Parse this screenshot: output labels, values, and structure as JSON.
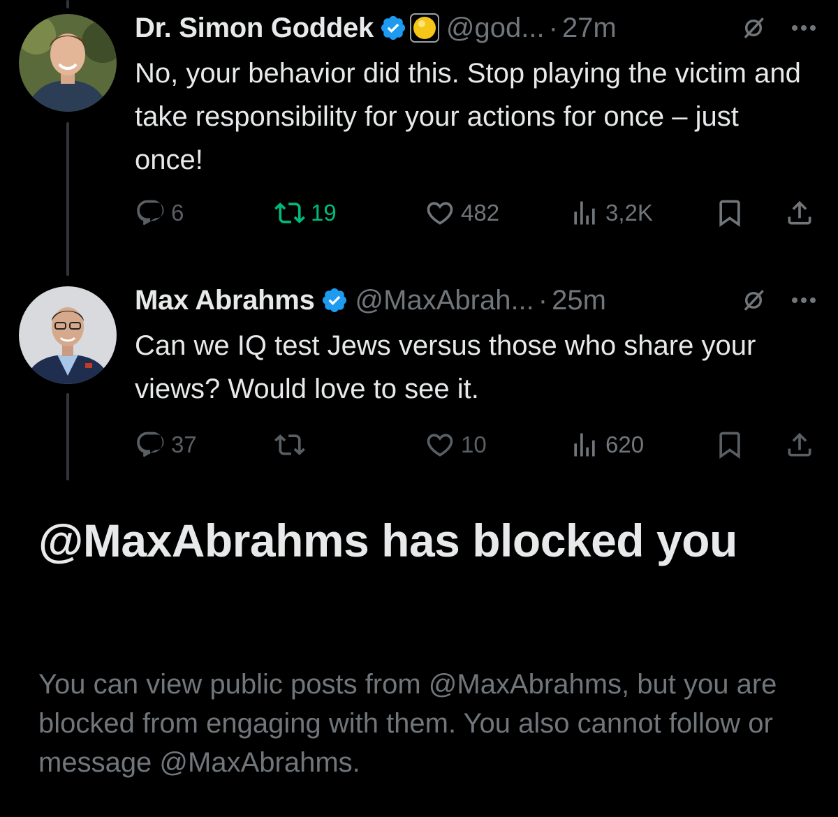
{
  "colors": {
    "background": "#000000",
    "primary_text": "#e7e9ea",
    "secondary_text": "#71767b",
    "verified_blue": "#1d9bf0",
    "retweet_green": "#00ba7c",
    "thread_line": "#333639"
  },
  "posts": [
    {
      "author_name": "Dr. Simon Goddek",
      "handle": "@god...",
      "separator": "·",
      "time": "27m",
      "verified": true,
      "badge_icon": "yellow-circle-emoji-icon",
      "text": "No, your behavior did this. Stop playing the victim and take responsibility for your actions for once – just once!",
      "stats": {
        "replies": "6",
        "reposts": "19",
        "likes": "482",
        "views": "3,2K"
      },
      "reposted": true
    },
    {
      "author_name": "Max Abrahms",
      "handle": "@MaxAbrah...",
      "separator": "·",
      "time": "25m",
      "verified": true,
      "text": "Can we IQ test Jews versus those who share your views? Would love to see it.",
      "stats": {
        "replies": "37",
        "reposts": "",
        "likes": "10",
        "views": "620"
      },
      "reposted": false
    }
  ],
  "block_notice": {
    "title": "@MaxAbrahms has blocked you",
    "body": "You can view public posts from @MaxAbrahms, but you are blocked from engaging with them. You also cannot follow or message @MaxAbrahms."
  }
}
